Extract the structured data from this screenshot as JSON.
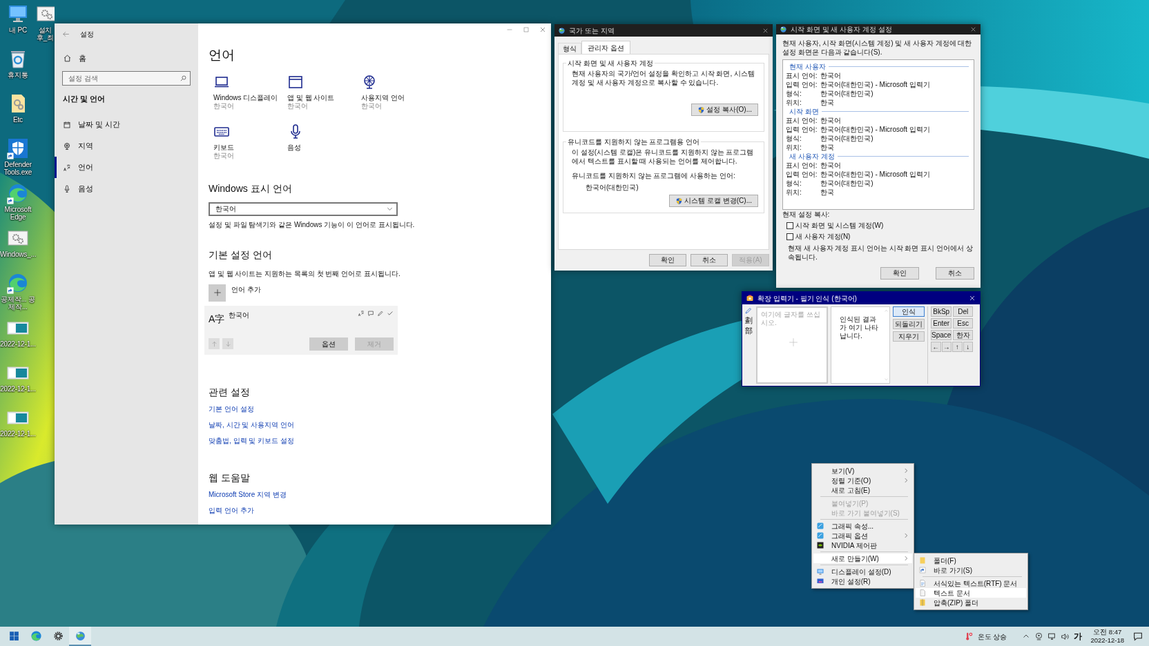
{
  "desktop_columns": [
    [
      {
        "label": "내 PC",
        "kind": "pc",
        "shortcut": false
      },
      {
        "label": "휴지통",
        "kind": "recycle",
        "shortcut": false
      },
      {
        "label": "Etc",
        "kind": "folder",
        "shortcut": false
      },
      {
        "label": "Defender Tools.exe",
        "kind": "shield",
        "shortcut": true
      },
      {
        "label": "Microsoft Edge",
        "kind": "edge",
        "shortcut": true
      },
      {
        "label": "Windows_...",
        "kind": "config",
        "shortcut": false
      },
      {
        "label": "공제작... 공제작...",
        "kind": "edge",
        "shortcut": true
      },
      {
        "label": "2022-12-1...",
        "kind": "screenshot",
        "shortcut": false
      },
      {
        "label": "2022-12-1...",
        "kind": "screenshot",
        "shortcut": false
      },
      {
        "label": "2022-12-1...",
        "kind": "screenshot",
        "shortcut": false
      }
    ],
    [
      {
        "label": "설치 후_최",
        "kind": "config",
        "shortcut": false
      }
    ]
  ],
  "settings": {
    "title": "설정",
    "home": "홈",
    "search": {
      "placeholder": "설정 검색"
    },
    "section": "시간 및 언어",
    "nav": [
      {
        "label": "날짜 및 시간",
        "kind": "calendar",
        "selected": false
      },
      {
        "label": "지역",
        "kind": "globe",
        "selected": false
      },
      {
        "label": "언어",
        "kind": "language",
        "selected": true
      },
      {
        "label": "음성",
        "kind": "mic",
        "selected": false
      }
    ],
    "heading": "언어",
    "tiles": [
      {
        "label": "Windows 디스플레이",
        "sub": "한국어",
        "kind": "laptop"
      },
      {
        "label": "앱 및 웹 사이트",
        "sub": "한국어",
        "kind": "window"
      },
      {
        "label": "사용지역 언어",
        "sub": "한국어",
        "kind": "globe"
      },
      {
        "label": "키보드",
        "sub": "한국어",
        "kind": "keyboard"
      },
      {
        "label": "음성",
        "kind": "mic"
      }
    ],
    "display_language": {
      "heading": "Windows 표시 언어",
      "value": "한국어",
      "note": "설정 및 파일 탐색기와 같은 Windows 기능이 이 언어로 표시됩니다."
    },
    "preferred": {
      "heading": "기본 설정 언어",
      "note": "앱 및 웹 사이트는 지원하는 목록의 첫 번째 언어로 표시됩니다.",
      "add": "언어 추가",
      "languages": [
        {
          "glyph": "A字",
          "name": "한국어",
          "buttons": [
            {
              "label": "옵션",
              "disabled": false
            },
            {
              "label": "제거",
              "disabled": true
            }
          ]
        }
      ]
    },
    "sections": [
      {
        "heading": "관련 설정",
        "links": [
          "기본 언어 설정",
          "날짜, 시간 및 사용지역 언어",
          "맞춤법, 입력 및 키보드 설정"
        ]
      },
      {
        "heading": "웹 도움말",
        "links": [
          "Microsoft Store 지역 변경",
          "입력 언어 추가"
        ]
      }
    ]
  },
  "region_dialog": {
    "title": "국가 또는 지역",
    "tabs": [
      {
        "label": "형식",
        "selected": false
      },
      {
        "label": "관리자 옵션",
        "selected": true
      }
    ],
    "groups": [
      {
        "legend": "시작 화면 및 새 사용자 계정",
        "text": "현재 사용자의 국가/언어 설정을 확인하고 시작 화면, 시스템 계정 및 새 사용자 계정으로 복사할 수 있습니다.",
        "button": "설정 복사(O)..."
      },
      {
        "legend": "유니코드를 지원하지 않는 프로그램용 언어",
        "text": "이 설정(시스템 로캘)은 유니코드를 지원하지 않는 프로그램에서 텍스트를 표시할 때 사용되는 언어를 제어합니다.",
        "label": "유니코드를 지원하지 않는 프로그램에 사용하는 언어:",
        "value": "한국어(대한민국)",
        "button": "시스템 로캘 변경(C)..."
      }
    ],
    "buttons": [
      {
        "label": "확인",
        "disabled": false
      },
      {
        "label": "취소",
        "disabled": false
      },
      {
        "label": "적용(A)",
        "disabled": true
      }
    ]
  },
  "start_dialog": {
    "title": "시작 화면 및 새 사용자 계정 설정",
    "intro": "현재 사용자, 시작 화면(시스템 계정) 및 새 사용자 계정에 대한 설정 화면은 다음과 같습니다(S).",
    "sections": [
      {
        "heading": "현재 사용자",
        "rows": [
          {
            "label": "표시 언어:",
            "value": "한국어"
          },
          {
            "label": "입력 언어:",
            "value": "한국어(대한민국) - Microsoft 입력기"
          },
          {
            "label": "형식:",
            "value": "한국어(대한민국)"
          },
          {
            "label": "위치:",
            "value": "한국"
          }
        ]
      },
      {
        "heading": "시작 화면",
        "rows": [
          {
            "label": "표시 언어:",
            "value": "한국어"
          },
          {
            "label": "입력 언어:",
            "value": "한국어(대한민국) - Microsoft 입력기"
          },
          {
            "label": "형식:",
            "value": "한국어(대한민국)"
          },
          {
            "label": "위치:",
            "value": "한국"
          }
        ]
      },
      {
        "heading": "새 사용자 계정",
        "rows": [
          {
            "label": "표시 언어:",
            "value": "한국어"
          },
          {
            "label": "입력 언어:",
            "value": "한국어(대한민국) - Microsoft 입력기"
          },
          {
            "label": "형식:",
            "value": "한국어(대한민국)"
          },
          {
            "label": "위치:",
            "value": "한국"
          }
        ]
      }
    ],
    "copy_label": "현재 설정 복사:",
    "checkboxes": [
      {
        "label": "시작 화면 및 시스템 계정(W)",
        "checked": false
      },
      {
        "label": "새 사용자 계정(N)",
        "checked": false
      }
    ],
    "note": "현재 새 사용자 계정 표시 언어는 시작 화면 표시 언어에서 상속됩니다.",
    "buttons": [
      "확인",
      "취소"
    ]
  },
  "ime": {
    "title": "확장 입력기 - 필기 인식 (한국어)",
    "tools": [
      "劃",
      "部"
    ],
    "placeholder": "여기에 글자를 쓰십시오.",
    "result": "인식된 결과가 여기 나타납니다.",
    "actions": [
      {
        "label": "인식",
        "default": true
      },
      {
        "label": "되돌리기",
        "default": false
      },
      {
        "label": "지우기",
        "default": false
      }
    ],
    "keys": [
      "BkSp",
      "Del",
      "Enter",
      "Esc",
      "Space",
      "한자"
    ],
    "arrow_keys": [
      "←",
      "→",
      "↑",
      "↓"
    ]
  },
  "context_menu": {
    "items": [
      {
        "kind": "item",
        "label": "보기(V)",
        "submenu": true,
        "disabled": false,
        "selected": false
      },
      {
        "kind": "item",
        "label": "정렬 기준(O)",
        "submenu": true,
        "disabled": false,
        "selected": false
      },
      {
        "kind": "item",
        "label": "새로 고침(E)",
        "submenu": false,
        "disabled": false,
        "selected": false
      },
      {
        "kind": "separator"
      },
      {
        "kind": "item",
        "label": "붙여넣기(P)",
        "submenu": false,
        "disabled": true,
        "selected": false
      },
      {
        "kind": "item",
        "label": "바로 가기 붙여넣기(S)",
        "submenu": false,
        "disabled": true,
        "selected": false
      },
      {
        "kind": "separator"
      },
      {
        "kind": "graphics",
        "label": "그래픽 속성...",
        "submenu": false,
        "disabled": false,
        "selected": false
      },
      {
        "kind": "graphics",
        "label": "그래픽 옵션",
        "submenu": true,
        "disabled": false,
        "selected": false
      },
      {
        "kind": "nvidia",
        "label": "NVIDIA 제어판",
        "submenu": false,
        "disabled": false,
        "selected": false
      },
      {
        "kind": "separator"
      },
      {
        "kind": "item",
        "label": "새로 만들기(W)",
        "submenu": true,
        "disabled": false,
        "selected": true
      },
      {
        "kind": "separator"
      },
      {
        "kind": "display",
        "label": "디스플레이 설정(D)",
        "submenu": false,
        "disabled": false,
        "selected": false
      },
      {
        "kind": "personalize",
        "label": "개인 설정(R)",
        "submenu": false,
        "disabled": false,
        "selected": false
      }
    ]
  },
  "submenu": {
    "items": [
      {
        "kind": "folder",
        "label": "폴더(F)",
        "selected": false
      },
      {
        "kind": "shortcut",
        "label": "바로 가기(S)",
        "selected": false
      },
      {
        "kind": "separator"
      },
      {
        "kind": "rtf",
        "label": "서식있는 텍스트(RTF) 문서",
        "selected": false
      },
      {
        "kind": "text",
        "label": "텍스트 문서",
        "selected": true
      },
      {
        "kind": "zip",
        "label": "압축(ZIP) 폴더",
        "selected": false
      }
    ]
  },
  "taskbar": {
    "apps": [
      {
        "kind": "start",
        "selected": false
      },
      {
        "kind": "edge",
        "selected": false
      },
      {
        "kind": "settings",
        "selected": false
      },
      {
        "kind": "globe",
        "selected": true
      }
    ],
    "weather": "온도 상승",
    "ime_mode": "가",
    "time": "오전 8:47",
    "date": "2022-12-18"
  }
}
